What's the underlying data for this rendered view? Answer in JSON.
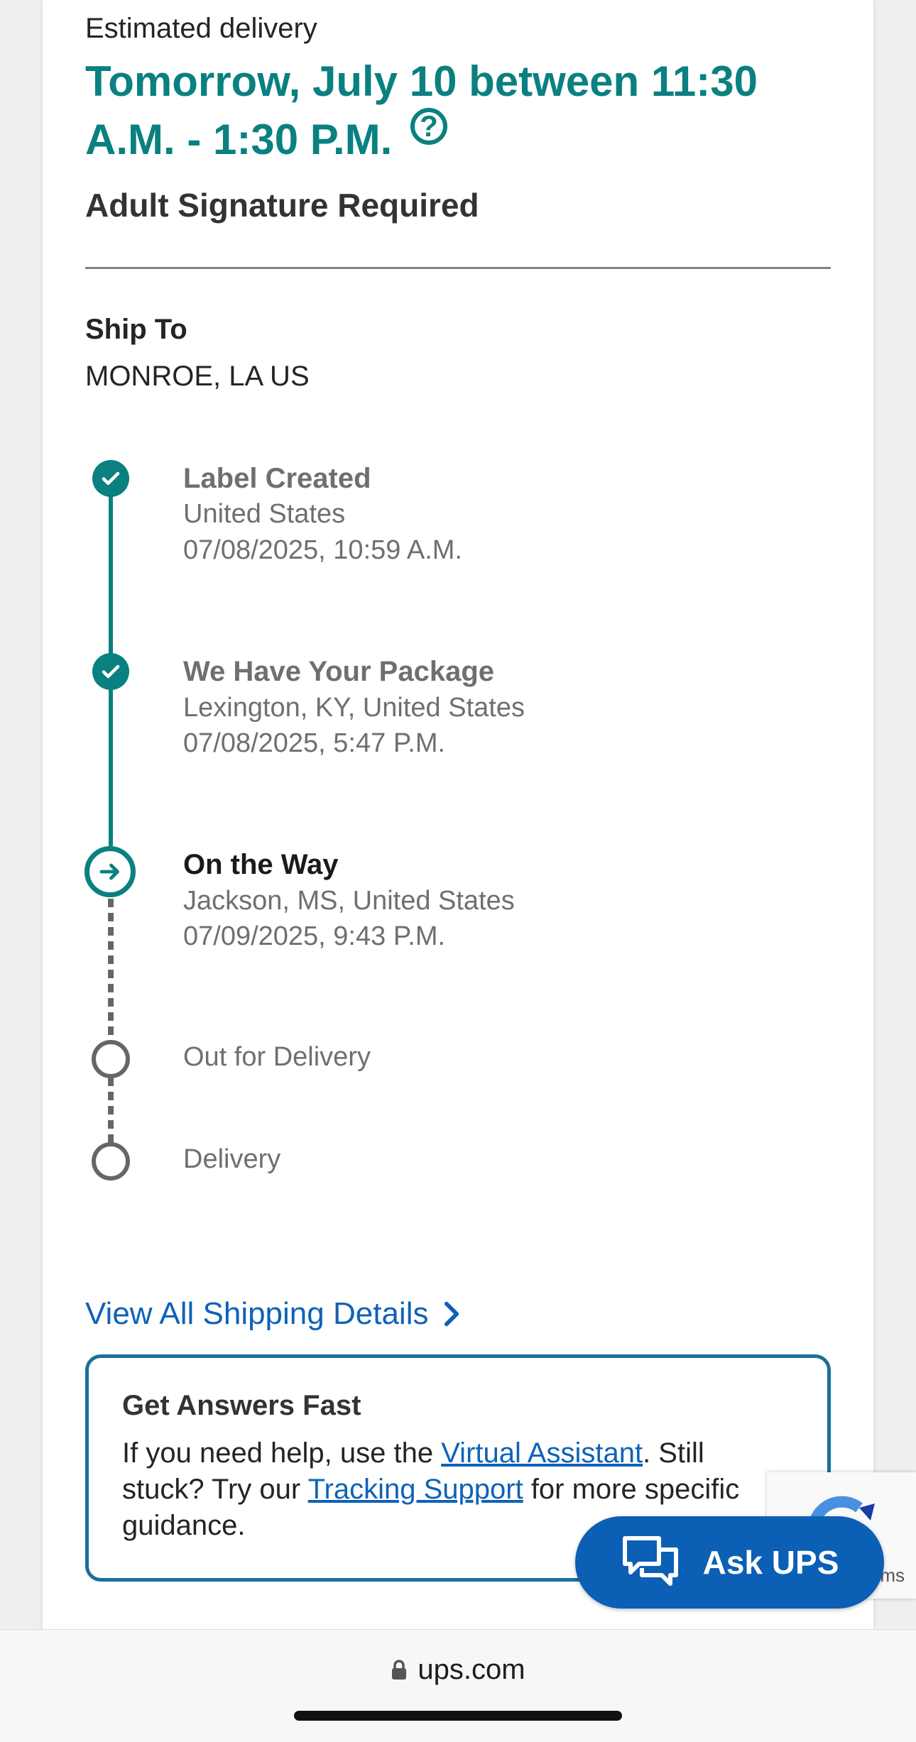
{
  "delivery": {
    "estimated_label": "Estimated delivery",
    "eta": "Tomorrow, July 10 between 11:30 A.M. - 1:30 P.M.",
    "help_icon": "question-circle-icon",
    "signature": "Adult Signature Required"
  },
  "ship_to": {
    "label": "Ship To",
    "value": "MONROE, LA US"
  },
  "progress": {
    "steps": [
      {
        "title": "Label Created",
        "location": "United States",
        "datetime": "07/08/2025, 10:59 A.M.",
        "status": "done"
      },
      {
        "title": "We Have Your Package",
        "location": "Lexington, KY, United States",
        "datetime": "07/08/2025, 5:47 P.M.",
        "status": "done"
      },
      {
        "title": "On the Way",
        "location": "Jackson, MS, United States",
        "datetime": "07/09/2025, 9:43 P.M.",
        "status": "current"
      },
      {
        "title": "Out for Delivery",
        "status": "pending"
      },
      {
        "title": "Delivery",
        "status": "pending"
      }
    ]
  },
  "details_link": "View All Shipping Details",
  "help_box": {
    "title": "Get Answers Fast",
    "text_1": "If you need help, use the ",
    "link_1": "Virtual Assistant",
    "text_2": ". Still stuck? Try our ",
    "link_2": "Tracking Support",
    "text_3": " for more specific guidance."
  },
  "recaptcha": {
    "label": "ms"
  },
  "chat_button": {
    "label": "Ask UPS",
    "icon": "chat-bubbles-icon"
  },
  "browser": {
    "url": "ups.com",
    "icon": "lock-icon"
  },
  "colors": {
    "teal": "#0a8080",
    "link_blue": "#0e62b8",
    "button_blue": "#0b5fb5"
  }
}
